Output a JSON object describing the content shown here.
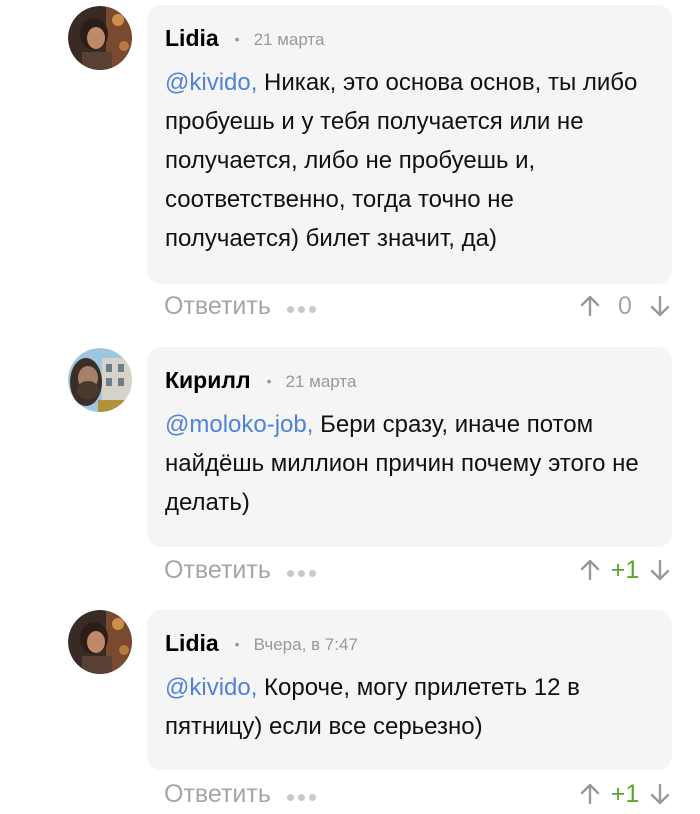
{
  "comments": [
    {
      "author": "Lidia",
      "date": "21 марта",
      "mention": "@kivido,",
      "text": " Никак, это основа основ, ты либо пробуешь и у тебя получается или не получается, либо не пробуешь и, соответственно, тогда точно не получается) билет значит, да)",
      "reply_label": "Ответить",
      "score": "0",
      "avatar": "woman-portrait-avatar"
    },
    {
      "author": "Кирилл",
      "date": "21 марта",
      "mention": "@moloko-job,",
      "text": " Бери сразу, иначе потом найдёшь миллион причин почему этого не делать)",
      "reply_label": "Ответить",
      "score": "+1",
      "avatar": "man-selfie-avatar"
    },
    {
      "author": "Lidia",
      "date": "Вчера, в 7:47",
      "mention": "@kivido,",
      "text": " Короче, могу прилететь 12 в пятницу) если все серьезно)",
      "reply_label": "Ответить",
      "score": "+1",
      "avatar": "woman-portrait-avatar"
    }
  ],
  "colors": {
    "mention": "#4f82d8",
    "positive_score": "#5aa72d",
    "muted": "#a6a6a6",
    "bubble": "#f5f5f5"
  },
  "icons": [
    "upvote-arrow-icon",
    "downvote-arrow-icon",
    "more-dots-icon"
  ]
}
